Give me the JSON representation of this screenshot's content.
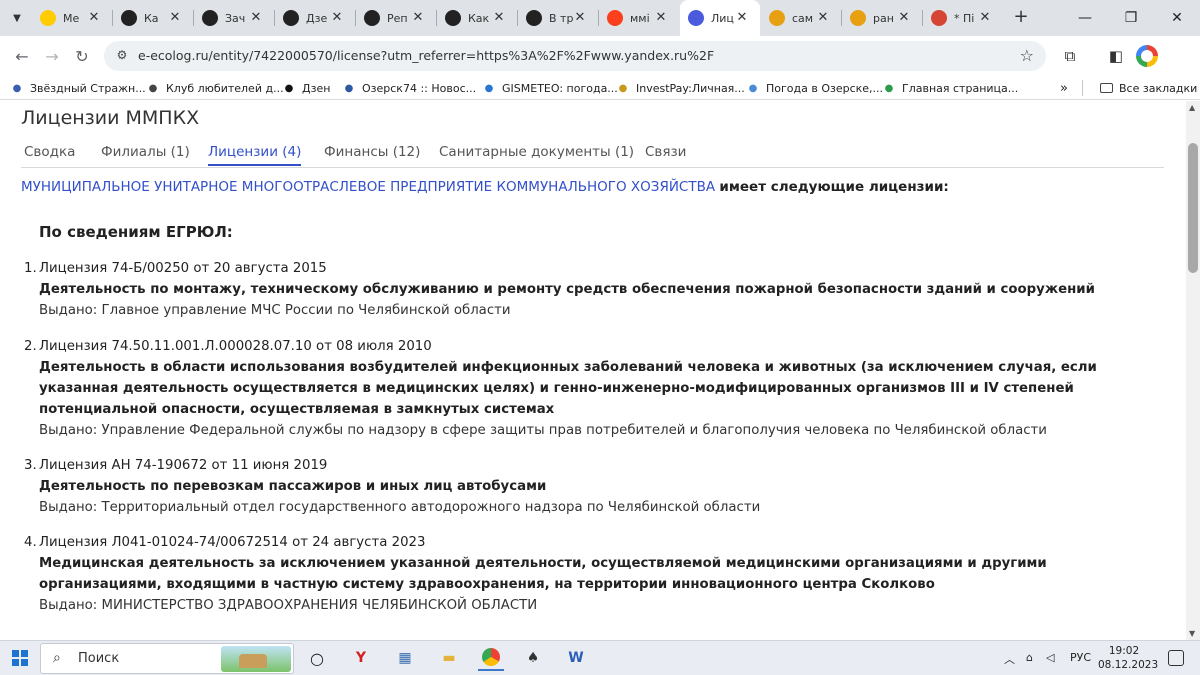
{
  "browser": {
    "tabs": [
      {
        "title": "Ме",
        "icon": "youtube-icon",
        "color": "#ffcc00"
      },
      {
        "title": "Ка",
        "icon": "plus-circle-icon",
        "color": "#222222"
      },
      {
        "title": "Зач",
        "icon": "plus-circle-icon",
        "color": "#222222"
      },
      {
        "title": "Дзе",
        "icon": "plus-circle-icon",
        "color": "#222222"
      },
      {
        "title": "Реп",
        "icon": "plus-circle-icon",
        "color": "#222222"
      },
      {
        "title": "Как",
        "icon": "plus-circle-icon",
        "color": "#222222"
      },
      {
        "title": "В тр",
        "icon": "plus-circle-icon",
        "color": "#222222"
      },
      {
        "title": "ммі",
        "icon": "yandex-icon",
        "color": "#fc3f1d"
      },
      {
        "title": "Лиц",
        "icon": "document-icon",
        "color": "#4b5bdc"
      },
      {
        "title": "сам",
        "icon": "image-icon",
        "color": "#e8a013"
      },
      {
        "title": "ран",
        "icon": "image-icon",
        "color": "#e8a013"
      },
      {
        "title": "* Пі",
        "icon": "mail-icon",
        "color": "#d64434"
      }
    ],
    "active_tab_index": 8,
    "url": "e-ecolog.ru/entity/7422000570/license?utm_referrer=https%3A%2F%2Fwww.yandex.ru%2F",
    "bookmarks": [
      {
        "label": "Звёздный Стражн...",
        "icon": "person-icon"
      },
      {
        "label": "Клуб любителей д...",
        "icon": "club-icon"
      },
      {
        "label": "Дзен",
        "icon": "dzen-icon"
      },
      {
        "label": "Озерск74 :: Новос...",
        "icon": "news-icon"
      },
      {
        "label": "GISMETEO: погода...",
        "icon": "g-icon"
      },
      {
        "label": "InvestPay:Личная...",
        "icon": "coin-icon"
      },
      {
        "label": "Погода в Озерске,...",
        "icon": "weather-icon"
      },
      {
        "label": "Главная страница...",
        "icon": "green-leaf-icon"
      }
    ],
    "more_bookmarks": "»",
    "all_bookmarks": "Все закладки"
  },
  "page": {
    "title": "Лицензии ММПКХ",
    "tabs": [
      "Сводка",
      "Филиалы (1)",
      "Лицензии (4)",
      "Финансы (12)",
      "Санитарные документы (1)",
      "Связи"
    ],
    "active_tab_index": 2,
    "intro_link": "МУНИЦИПАЛЬНОЕ УНИТАРНОЕ МНОГООТРАСЛЕВОЕ ПРЕДПРИЯТИЕ КОММУНАЛЬНОГО ХОЗЯЙСТВА",
    "intro_rest": "имеет следующие лицензии:",
    "section_heading": "По сведениям ЕГРЮЛ:",
    "licenses": [
      {
        "num": "1.",
        "header": "Лицензия 74-Б/00250 от 20 августа 2015",
        "activity": "Деятельность по монтажу, техническому обслуживанию и ремонту средств обеспечения пожарной безопасности зданий и сооружений",
        "issued": "Выдано: Главное управление МЧС России по Челябинской области"
      },
      {
        "num": "2.",
        "header": "Лицензия 74.50.11.001.Л.000028.07.10 от 08 июля 2010",
        "activity": "Деятельность в области использования возбудителей инфекционных заболеваний человека и животных (за исключением случая, если указанная деятельность осуществляется в медицинских целях) и генно-инженерно-модифицированных организмов III и IV степеней потенциальной опасности, осуществляемая в замкнутых системах",
        "issued": "Выдано: Управление Федеральной службы по надзору в сфере защиты прав потребителей и благополучия человека по Челябинской области"
      },
      {
        "num": "3.",
        "header": "Лицензия АН 74-190672 от 11 июня 2019",
        "activity": "Деятельность по перевозкам пассажиров и иных лиц автобусами",
        "issued": "Выдано: Территориальный отдел государственного автодорожного надзора по Челябинской области"
      },
      {
        "num": "4.",
        "header": "Лицензия Л041-01024-74/00672514 от 24 августа 2023",
        "activity": "Медицинская деятельность за исключением указанной деятельности, осуществляемой медицинскими организациями и другими организациями, входящими в частную систему здравоохранения, на территории инновационного центра Сколково",
        "issued": "Выдано: МИНИСТЕРСТВО ЗДРАВООХРАНЕНИЯ ЧЕЛЯБИНСКОЙ ОБЛАСТИ"
      }
    ]
  },
  "taskbar": {
    "search_placeholder": "Поиск",
    "language": "РУС",
    "time": "19:02",
    "date": "08.12.2023"
  },
  "colors": {
    "link": "#3350c9",
    "tab_strip": "#dfe3e7",
    "taskbar": "#e9edf3"
  }
}
